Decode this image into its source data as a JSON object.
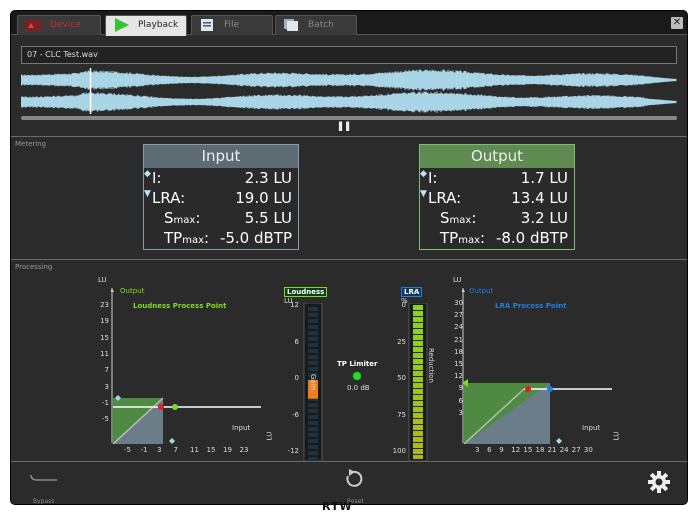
{
  "tabs": {
    "device": "Device",
    "playback": "Playback",
    "file": "File",
    "batch": "Batch"
  },
  "playback": {
    "filename": "07 - CLC Test.wav",
    "transport": "▌▌",
    "play_position": 0.106
  },
  "metering": {
    "section_label": "Metering",
    "input": {
      "title": "Input",
      "I_label": "I:",
      "I_value": "2.3 LU",
      "LRA_label": "LRA:",
      "LRA_value": "19.0 LU",
      "Smax_label_main": "S",
      "Smax_label_sub": "max",
      "Smax_value": "5.5 LU",
      "TPmax_label_main": "TP",
      "TPmax_label_sub": "max",
      "TPmax_value": "-5.0 dBTP"
    },
    "output": {
      "title": "Output",
      "I_label": "I:",
      "I_value": "1.7 LU",
      "LRA_label": "LRA:",
      "LRA_value": "13.4 LU",
      "Smax_label_main": "S",
      "Smax_label_sub": "max",
      "Smax_value": "3.2 LU",
      "TPmax_label_main": "TP",
      "TPmax_label_sub": "max",
      "TPmax_value": "-8.0 dBTP"
    }
  },
  "processing": {
    "section_label": "Processing",
    "loudness_graph": {
      "unit": "LU",
      "output_label": "Output",
      "input_label": "Input",
      "title": "Loudness Process Point",
      "y_ticks": [
        "23",
        "19",
        "15",
        "11",
        "7",
        "3",
        "-1",
        "-5"
      ],
      "x_ticks": [
        "-5",
        "-1",
        "3",
        "7",
        "11",
        "15",
        "19",
        "23"
      ],
      "x_unit": "LU"
    },
    "loudness_meter": {
      "badge": "Loudness",
      "unit": "LU",
      "ticks": [
        "12",
        "6",
        "0",
        "-6",
        "-12"
      ],
      "side_label": "Gain",
      "gain_value": -3
    },
    "tp_limiter": {
      "label": "TP Limiter",
      "value": "0.0 dB"
    },
    "lra_meter": {
      "badge": "LRA",
      "unit": "%",
      "ticks": [
        "0",
        "25",
        "50",
        "75",
        "100"
      ],
      "side_label": "Reduction",
      "reduction_percent": 100
    },
    "lra_graph": {
      "unit": "LU",
      "output_label": "Output",
      "input_label": "Input",
      "title": "LRA Process Point",
      "y_ticks": [
        "30",
        "27",
        "24",
        "21",
        "18",
        "15",
        "12",
        "9",
        "6",
        "3"
      ],
      "x_ticks": [
        "3",
        "6",
        "9",
        "12",
        "15",
        "18",
        "21",
        "24",
        "27",
        "30"
      ],
      "x_unit": "LU"
    }
  },
  "bottom": {
    "bypass_label": "Bypass",
    "reset_label": "Reset"
  },
  "brand": "RTW",
  "colors": {
    "accent_green": "#7ddc1f",
    "accent_blue": "#1e7fe0",
    "waveform": "#a9d5e6",
    "meter_orange": "#f07e1a"
  }
}
